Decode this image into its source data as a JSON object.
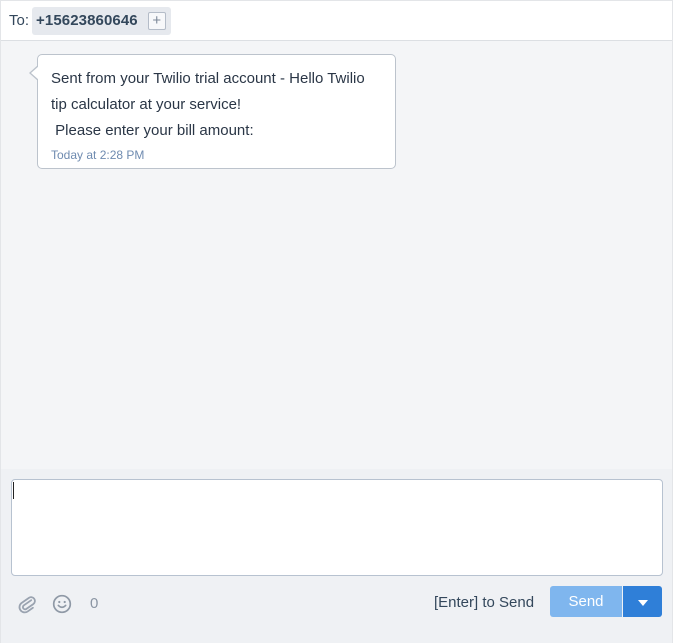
{
  "header": {
    "to_label": "To:",
    "recipient": "+15623860646",
    "add_recipient_symbol": "+"
  },
  "messages": [
    {
      "lines": [
        "Sent from your Twilio trial account - Hello Twilio",
        "tip calculator at your service!",
        " Please enter your bill amount:"
      ],
      "timestamp": "Today at 2:28 PM"
    }
  ],
  "composer": {
    "value": "",
    "char_count": "0",
    "enter_hint": "[Enter] to Send",
    "send_label": "Send",
    "icons": {
      "attach": "paperclip-icon",
      "emoji": "smiley-icon",
      "send_options": "caret-down-icon"
    }
  },
  "colors": {
    "send_button": "#7fb6ee",
    "send_options_button": "#2f7fd8",
    "timestamp": "#6f8bb0",
    "background": "#f4f5f7"
  }
}
